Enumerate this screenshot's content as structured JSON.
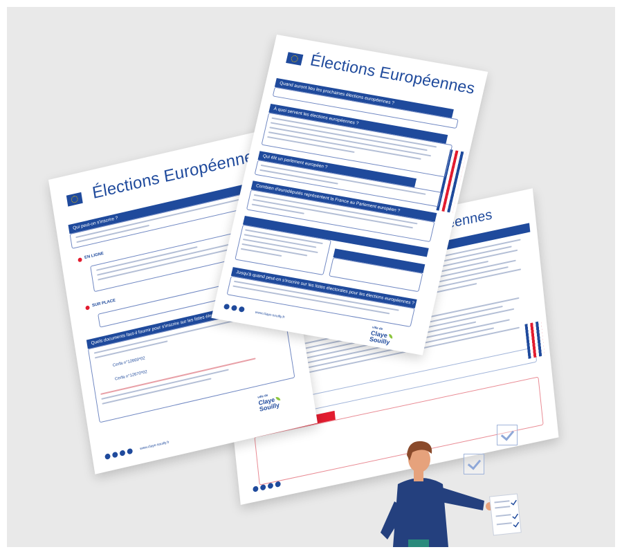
{
  "document_title": "Élections Européennes",
  "front_sheet": {
    "questions": [
      "Quand auront lieu les prochaines élections européennes ?",
      "À quoi servent les élections européennes ?",
      "Qui élit un parlement européen ?",
      "Combien d'eurodéputés représentent la France au Parlement européen ?",
      "Jusqu'à quand peut-on s'inscrire sur les listes électorales pour les élections européennes ?"
    ]
  },
  "left_sheet": {
    "question_1": "Qui peut-on s'inscrire ?",
    "label_online": "EN LIGNE",
    "label_on_site": "SUR PLACE",
    "question_2": "Quels documents faut-il fournir pour s'inscrire sur les listes électorales ?",
    "form_1": "Cerfa n°12669*02",
    "form_2": "Cerfa n°12670*02"
  },
  "back_sheet": {
    "title_fragment": "uropéennes"
  },
  "branding": {
    "org_prefix": "ville de",
    "org_name_line1": "Claye",
    "org_name_line2": "Souilly",
    "website": "www.claye-souilly.fr"
  },
  "colors": {
    "accent_blue": "#1f4a9c",
    "flag_red": "#e21c2f",
    "person_jacket": "#24407e",
    "person_hair": "#8a4a2b"
  },
  "icons": [
    "eu-flag-icon",
    "checkmark-box-icon",
    "social-icons"
  ]
}
